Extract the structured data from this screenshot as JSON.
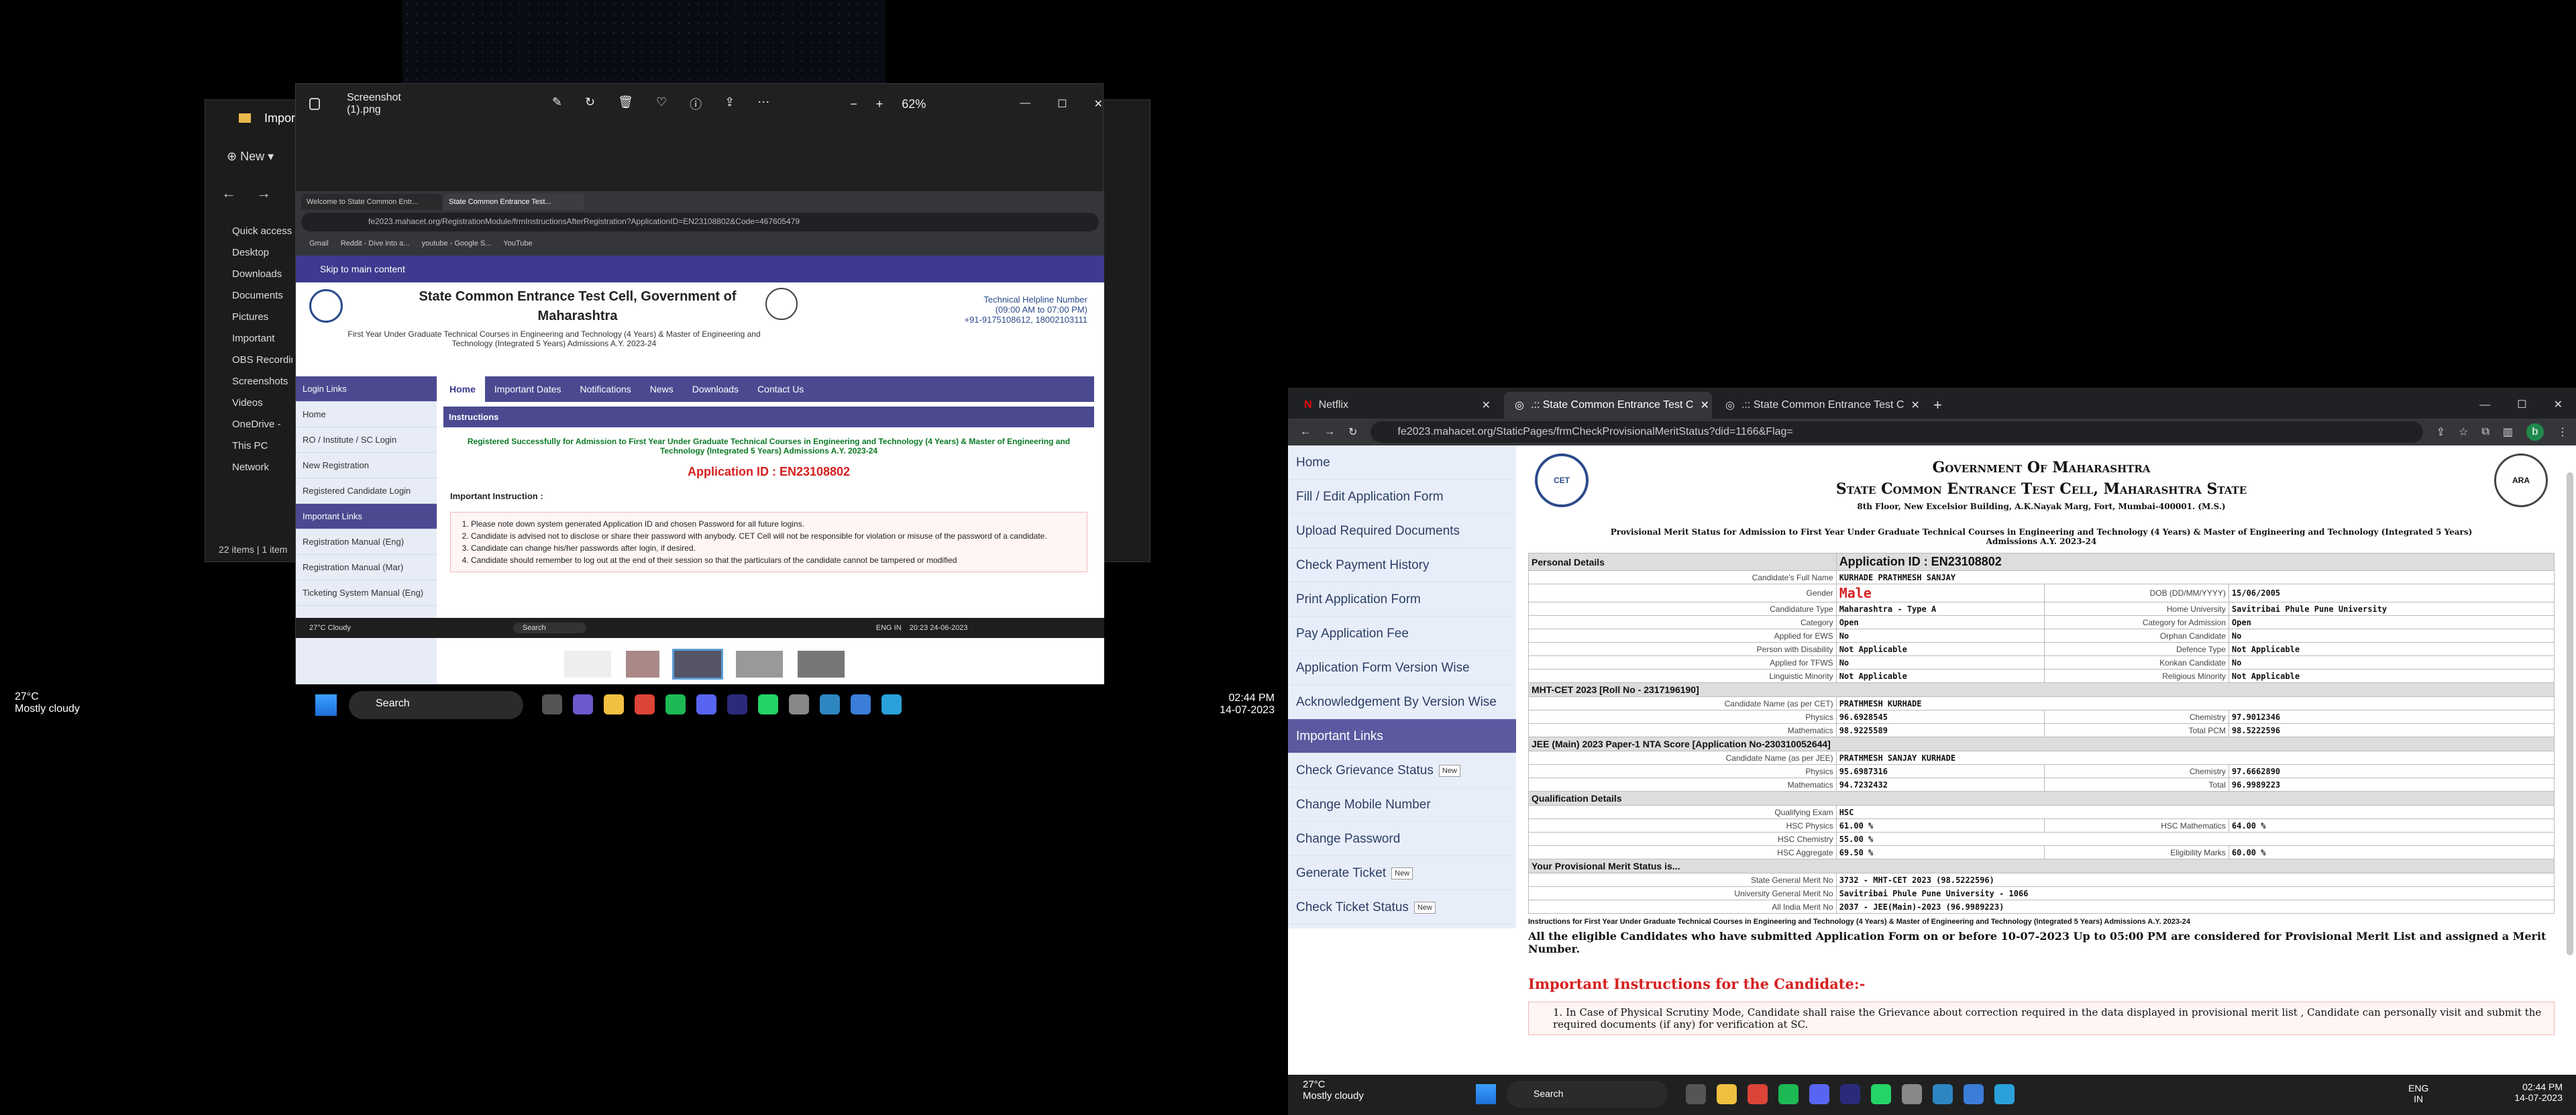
{
  "explorer": {
    "title": "Important Documents",
    "new_label": "New",
    "sidebar": [
      "Quick access",
      "Desktop",
      "Downloads",
      "Documents",
      "Pictures",
      "Important",
      "OBS Recordings",
      "Screenshots",
      "Videos",
      "OneDrive -",
      "This PC",
      "Network"
    ],
    "status": "22 items | 1 item"
  },
  "photos": {
    "title": "Screenshot (1).png",
    "zoom": "62%"
  },
  "mini_chrome": {
    "tabs": [
      "Welcome to State Common Entr...",
      "State Common Entrance Test..."
    ],
    "url": "fe2023.mahacet.org/RegistrationModule/frmInstructionsAfterRegistration?ApplicationID=EN23108802&Code=467605479",
    "bookmarks": [
      "Gmail",
      "Reddit - Dive into a...",
      "youtube - Google S...",
      "YouTube"
    ]
  },
  "mini_site": {
    "skip": "Skip to main content",
    "title1": "State Common Entrance Test Cell, Government of",
    "title2": "Maharashtra",
    "subtitle": "First Year Under Graduate Technical Courses in Engineering and Technology (4 Years) & Master of Engineering and Technology (Integrated 5 Years) Admissions A.Y. 2023-24",
    "helpline": "Technical Helpline Number",
    "hours": "(09:00 AM to 07:00 PM)",
    "phones": "+91-9175108612, 18002103111",
    "nav": [
      "Home",
      "Important Dates",
      "Notifications",
      "News",
      "Downloads",
      "Contact Us"
    ],
    "login_links": [
      "Login Links",
      "Home",
      "RO / Institute / SC Login",
      "New Registration",
      "Registered Candidate Login",
      "Important Links",
      "Registration Manual (Eng)",
      "Registration Manual (Mar)",
      "Ticketing System Manual (Eng)"
    ],
    "instructions_head": "Instructions",
    "registered": "Registered Successfully for Admission to First Year Under Graduate Technical Courses in Engineering and Technology (4 Years) & Master of Engineering and Technology (Integrated 5 Years) Admissions A.Y. 2023-24",
    "app_id": "Application ID : EN23108802",
    "important": "Important Instruction :",
    "points": [
      "Please note down system generated Application ID and chosen Password for all future logins.",
      "Candidate is advised not to disclose or share their password with anybody. CET Cell will not be responsible for violation or misuse of the password of a candidate.",
      "Candidate can change his/her passwords after login, if desired.",
      "Candidate should remember to log out at the end of their session so that the particulars of the candidate cannot be tampered or modified"
    ]
  },
  "mini_taskbar": {
    "temp": "27°C",
    "weather": "Cloudy",
    "search": "Search",
    "lang": "ENG",
    "region": "IN",
    "time": "20:23",
    "date": "24-06-2023"
  },
  "left_taskbar": {
    "temp": "27°C",
    "weather": "Mostly cloudy",
    "search": "Search",
    "time": "02:44 PM",
    "date": "14-07-2023"
  },
  "right_browser": {
    "tabs": [
      "Netflix",
      ".:: State Common Entrance Test C",
      ".:: State Common Entrance Test C"
    ],
    "url": "fe2023.mahacet.org/StaticPages/frmCheckProvisionalMeritStatus?did=1166&Flag=",
    "profile": "b"
  },
  "menu": {
    "items": [
      "Home",
      "Fill / Edit Application Form",
      "Upload Required Documents",
      "Check Payment History",
      "Print Application Form",
      "Pay Application Fee",
      "Application Form Version Wise",
      "Acknowledgement By Version Wise"
    ],
    "important_links": "Important Links",
    "links": [
      "Check Grievance Status",
      "Change Mobile Number",
      "Change Password",
      "Generate Ticket",
      "Check Ticket Status"
    ],
    "new_badge": "New"
  },
  "doc": {
    "gov": "Government Of Maharashtra",
    "cell": "State Common Entrance Test Cell, Maharashtra State",
    "address": "8th Floor, New Excelsior Building, A.K.Nayak Marg, Fort, Mumbai-400001. (M.S.)",
    "merit_title": "Provisional Merit Status for Admission to First Year Under Graduate Technical Courses in Engineering and Technology (4 Years) & Master of Engineering and Technology (Integrated 5 Years) Admissions A.Y. 2023-24",
    "personal": "Personal Details",
    "app_id": "Application ID : EN23108802",
    "labels": {
      "full_name": "Candidate's Full Name",
      "gender": "Gender",
      "dob": "DOB (DD/MM/YYYY)",
      "ctype": "Candidature Type",
      "home_uni": "Home University",
      "category": "Category",
      "cat_adm": "Category for Admission",
      "ews": "Applied for EWS",
      "orphan": "Orphan Candidate",
      "pwd": "Person with Disability",
      "defence": "Defence Type",
      "tfws": "Applied for TFWS",
      "konkan": "Konkan Candidate",
      "ling": "Linguistic Minority",
      "relig": "Religious Minority"
    },
    "values": {
      "full_name": "KURHADE PRATHMESH SANJAY",
      "gender": "Male",
      "dob": "15/06/2005",
      "ctype": "Maharashtra - Type A",
      "home_uni": "Savitribai Phule Pune University",
      "category": "Open",
      "cat_adm": "Open",
      "ews": "No",
      "orphan": "No",
      "pwd": "Not Applicable",
      "defence": "Not Applicable",
      "tfws": "No",
      "konkan": "No",
      "ling": "Not Applicable",
      "relig": "Not Applicable"
    },
    "mhtcet": "MHT-CET 2023 [Roll No - 2317196190]",
    "cet_name_lab": "Candidate Name (as per CET)",
    "cet_name": "PRATHMESH KURHADE",
    "phy_lab": "Physics",
    "phy": "96.6928545",
    "chem_lab": "Chemistry",
    "chem": "97.9012346",
    "math_lab": "Mathematics",
    "math": "98.9225589",
    "pcm_lab": "Total PCM",
    "pcm": "98.5222596",
    "jee": "JEE (Main) 2023 Paper-1 NTA Score [Application No-230310052644]",
    "jee_name_lab": "Candidate Name (as per JEE)",
    "jee_name": "PRATHMESH SANJAY KURHADE",
    "jphy": "95.6987316",
    "jchem": "97.6662890",
    "jmath": "94.7232432",
    "jtot_lab": "Total",
    "jtot": "96.9989223",
    "qual": "Qualification Details",
    "qexam_lab": "Qualifying Exam",
    "qexam": "HSC",
    "hphy_lab": "HSC Physics",
    "hphy": "61.00 %",
    "hmath_lab": "HSC Mathematics",
    "hmath": "64.00 %",
    "hchem_lab": "HSC Chemistry",
    "hchem": "55.00 %",
    "hagg_lab": "HSC Aggregate",
    "hagg": "69.50 %",
    "elig_lab": "Eligibility Marks",
    "elig": "60.00 %",
    "merit_status": "Your Provisional Merit Status is...",
    "sgm_lab": "State General Merit No",
    "sgm": "3732 - MHT-CET 2023 (98.5222596)",
    "ugm_lab": "University General Merit No",
    "ugm": "Savitribai Phule Pune University - 1066",
    "aim_lab": "All India Merit No",
    "aim": "2037 - JEE(Main)-2023 (96.9989223)",
    "instr_line": "Instructions for First Year Under Graduate Technical Courses in Engineering and Technology (4 Years) & Master of Engineering and Technology (Integrated 5 Years) Admissions A.Y. 2023-24",
    "eligible": "All the eligible Candidates who have submitted Application Form on or before 10-07-2023 Up to 05:00 PM are considered for Provisional Merit List and assigned a Merit Number.",
    "imp_head": "Important Instructions for the Candidate:-",
    "imp1": "In Case of Physical Scrutiny Mode, Candidate shall raise the Grievance about correction required in the data displayed in provisional merit list , Candidate can personally visit and submit the required documents (if any) for verification at SC."
  },
  "right_taskbar": {
    "temp": "27°C",
    "weather": "Mostly cloudy",
    "search": "Search",
    "lang": "ENG",
    "region": "IN",
    "time": "02:44 PM",
    "date": "14-07-2023"
  }
}
